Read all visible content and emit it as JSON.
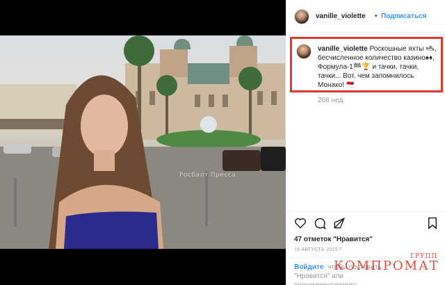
{
  "post": {
    "username": "vanille_violette",
    "follow_label": "Подписаться",
    "dot": "•",
    "caption_user": "vanille_violette",
    "caption_text": "Роскошные яхты 🛥, бесчисленное количество казино♠♦, Формула-1🏁🏆 и тачки, тачки, тачки... Вот, чем запомнилось Монако! 🇲🇨",
    "time_ago": "208 нед.",
    "likes": "47 отметок \"Нравится\"",
    "date": "16 АВГУСТА 2015 Г.",
    "login_link": "Войдите",
    "login_rest": ", чтобы поставить \"Нравится\" или прокомментировать.",
    "photo_watermark": "Росбалт Пресса"
  },
  "actions": [
    {
      "name": "like-heart-icon"
    },
    {
      "name": "comment-icon"
    },
    {
      "name": "share-icon"
    },
    {
      "name": "bookmark-icon"
    }
  ],
  "brand": {
    "main": "КОМПРОМАТ",
    "top": "ГРУПП"
  },
  "colors": {
    "highlight": "#e0362c",
    "link": "#3897f0",
    "text": "#262626",
    "muted": "#999999"
  }
}
